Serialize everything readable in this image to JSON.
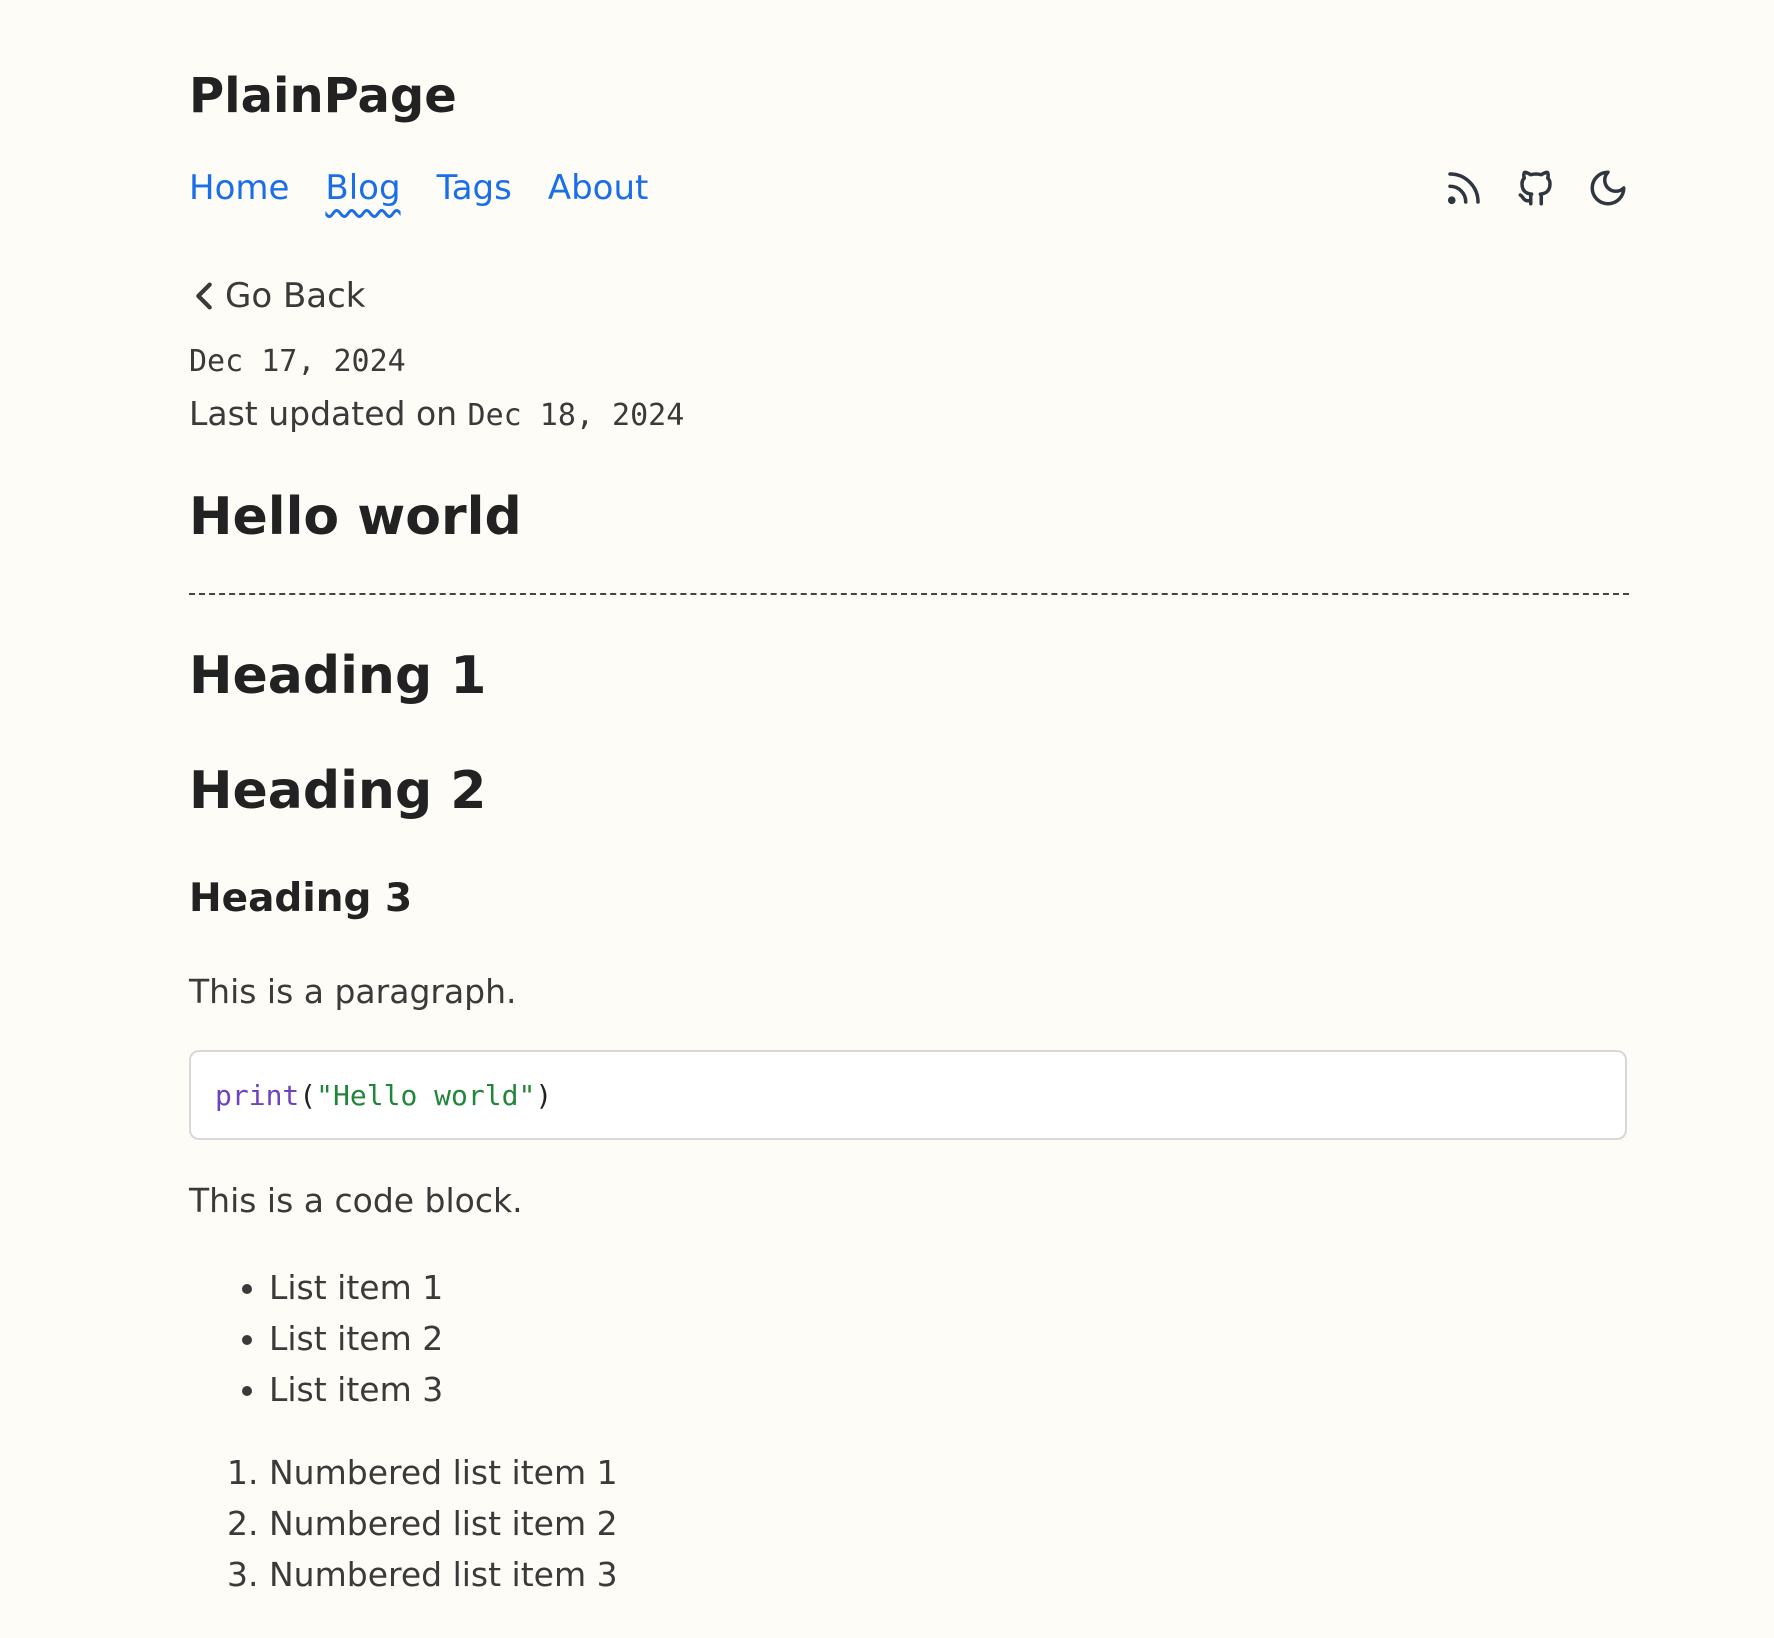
{
  "site": {
    "title": "PlainPage"
  },
  "nav": {
    "links": [
      {
        "label": "Home"
      },
      {
        "label": "Blog"
      },
      {
        "label": "Tags"
      },
      {
        "label": "About"
      }
    ],
    "active": "Blog",
    "icons": [
      "rss-icon",
      "github-icon",
      "moon-icon"
    ]
  },
  "post": {
    "back_label": "Go Back",
    "date": "Dec 17, 2024",
    "updated_prefix": "Last updated on",
    "updated_date": "Dec 18, 2024",
    "title": "Hello world",
    "heading1": "Heading 1",
    "heading2": "Heading 2",
    "heading3": "Heading 3",
    "paragraph": "This is a paragraph.",
    "code": {
      "fn": "print",
      "open": "(",
      "str": "\"Hello world\"",
      "close": ")"
    },
    "code_caption": "This is a code block.",
    "bullets": [
      "List item 1",
      "List item 2",
      "List item 3"
    ],
    "numbered": [
      "Numbered list item 1",
      "Numbered list item 2",
      "Numbered list item 3"
    ]
  },
  "colors": {
    "background": "#fefcf6",
    "link": "#1a6ee8",
    "heading": "#222222",
    "text": "#3a3a3a",
    "code_fn": "#6f42c1",
    "code_string": "#22863a"
  }
}
